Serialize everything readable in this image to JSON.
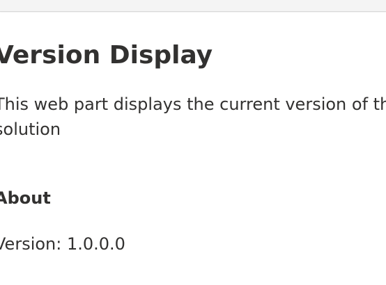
{
  "webpart": {
    "title": "Version Display",
    "description": "This web part displays the current version of the solution",
    "about_heading": "About",
    "version_label": "Version:",
    "version_value": "1.0.0.0"
  }
}
